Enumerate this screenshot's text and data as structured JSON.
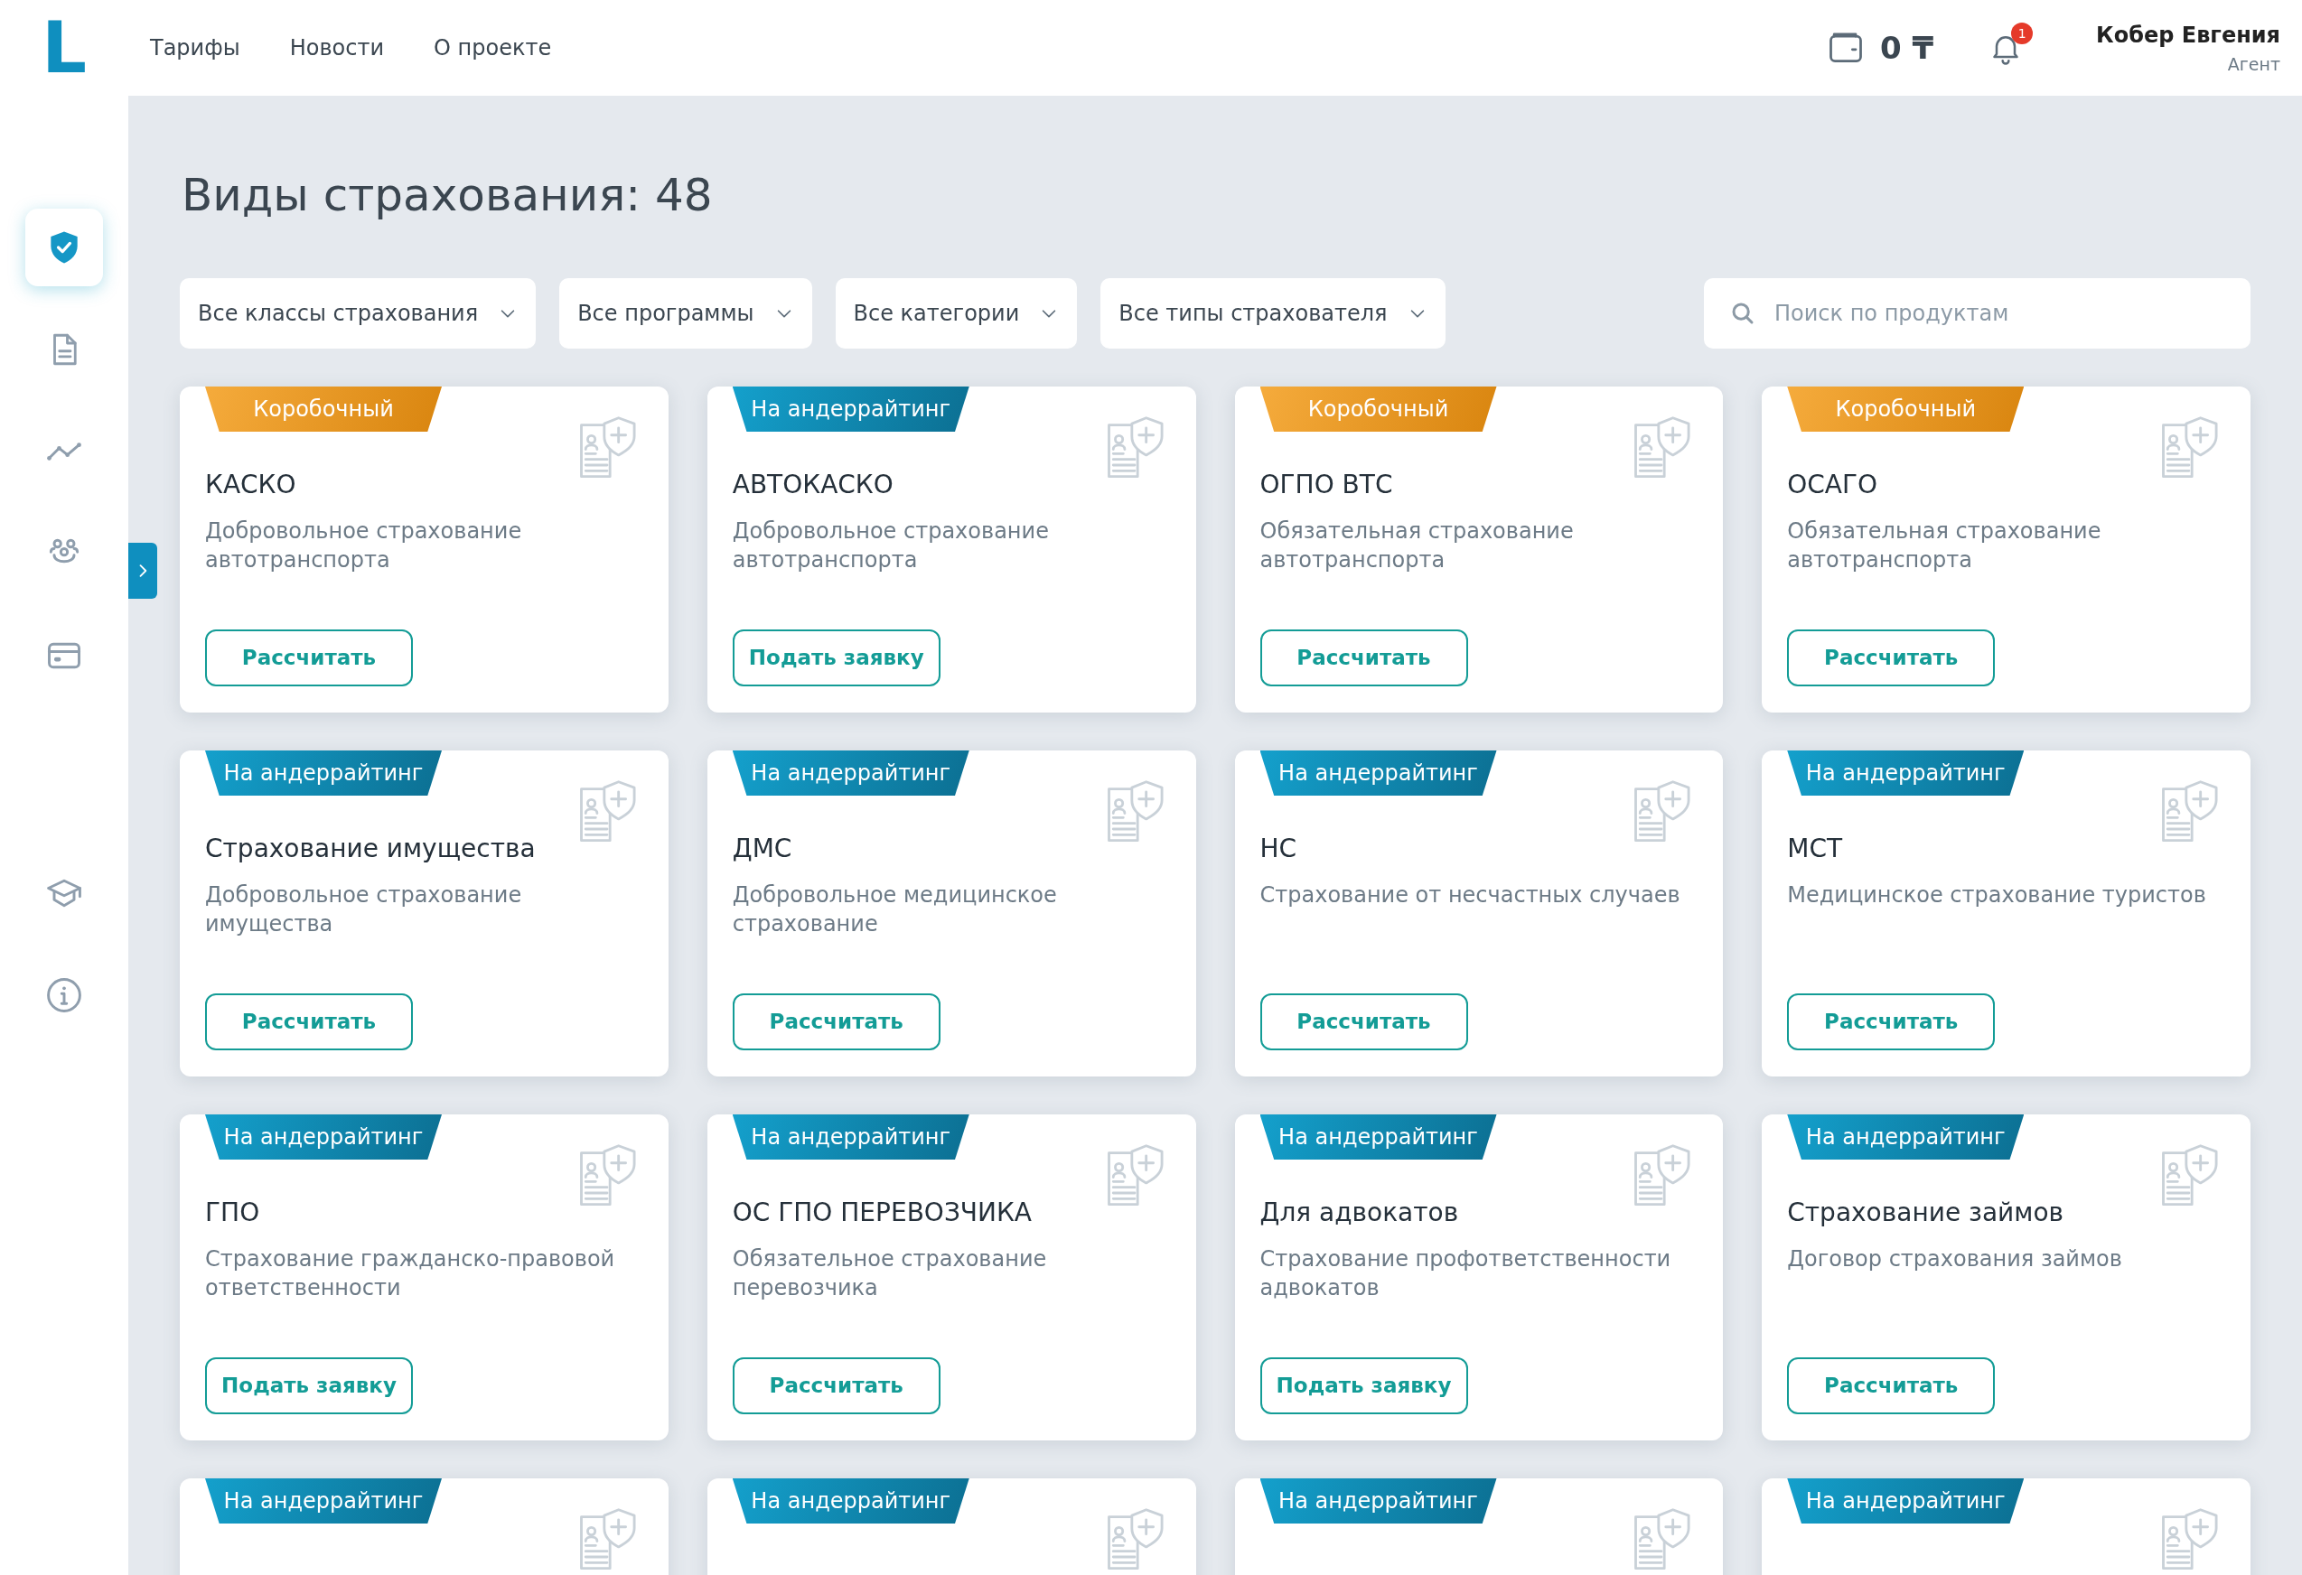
{
  "logo": "L",
  "nav": [
    "Тарифы",
    "Новости",
    "О проекте"
  ],
  "balance": "0 ₸",
  "notifications": "1",
  "user": {
    "name": "Кобер Евгения",
    "role": "Агент"
  },
  "sidebar": {
    "items": [
      {
        "selected": true
      },
      {
        "selected": false
      },
      {
        "selected": false
      },
      {
        "selected": false
      },
      {
        "selected": false
      },
      {
        "selected": false
      },
      {
        "selected": false
      }
    ]
  },
  "page_title": "Виды страхования: 48",
  "filters": [
    "Все классы страхования",
    "Все программы",
    "Все категории",
    "Все типы страхователя"
  ],
  "search": {
    "placeholder": "Поиск по продуктам"
  },
  "products": [
    {
      "badge": "Коробочный",
      "kind": "box",
      "title": "КАСКО",
      "description": "Добровольное страхование автотранспорта",
      "button": "Рассчитать"
    },
    {
      "badge": "На андеррайтинг",
      "kind": "underwriting",
      "title": "АВТОКАСКО",
      "description": "Добровольное страхование автотранспорта",
      "button": "Подать заявку"
    },
    {
      "badge": "Коробочный",
      "kind": "box",
      "title": "ОГПО ВТС",
      "description": "Обязательная страхование автотранспорта",
      "button": "Рассчитать"
    },
    {
      "badge": "Коробочный",
      "kind": "box",
      "title": "ОСАГО",
      "description": "Обязательная страхование автотранспорта",
      "button": "Рассчитать"
    },
    {
      "badge": "На андеррайтинг",
      "kind": "underwriting",
      "title": "Страхование имущества",
      "description": "Добровольное страхование имущества",
      "button": "Рассчитать"
    },
    {
      "badge": "На андеррайтинг",
      "kind": "underwriting",
      "title": "ДМС",
      "description": "Добровольное медицинское страхование",
      "button": "Рассчитать"
    },
    {
      "badge": "На андеррайтинг",
      "kind": "underwriting",
      "title": "НС",
      "description": "Страхование от несчастных случаев",
      "button": "Рассчитать"
    },
    {
      "badge": "На андеррайтинг",
      "kind": "underwriting",
      "title": "МСТ",
      "description": "Медицинское страхование туристов",
      "button": "Рассчитать"
    },
    {
      "badge": "На андеррайтинг",
      "kind": "underwriting",
      "title": "ГПО",
      "description": "Страхование гражданско-правовой ответственности",
      "button": "Подать заявку"
    },
    {
      "badge": "На андеррайтинг",
      "kind": "underwriting",
      "title": "ОС ГПО ПЕРЕВОЗЧИКА",
      "description": "Обязательное страхование перевозчика",
      "button": "Рассчитать"
    },
    {
      "badge": "На андеррайтинг",
      "kind": "underwriting",
      "title": "Для адвокатов",
      "description": "Страхование профответственности адвокатов",
      "button": "Подать заявку"
    },
    {
      "badge": "На андеррайтинг",
      "kind": "underwriting",
      "title": "Страхование займов",
      "description": "Договор страхования займов",
      "button": "Рассчитать"
    },
    {
      "badge": "На андеррайтинг",
      "kind": "underwriting"
    },
    {
      "badge": "На андеррайтинг",
      "kind": "underwriting"
    },
    {
      "badge": "На андеррайтинг",
      "kind": "underwriting"
    },
    {
      "badge": "На андеррайтинг",
      "kind": "underwriting"
    }
  ]
}
